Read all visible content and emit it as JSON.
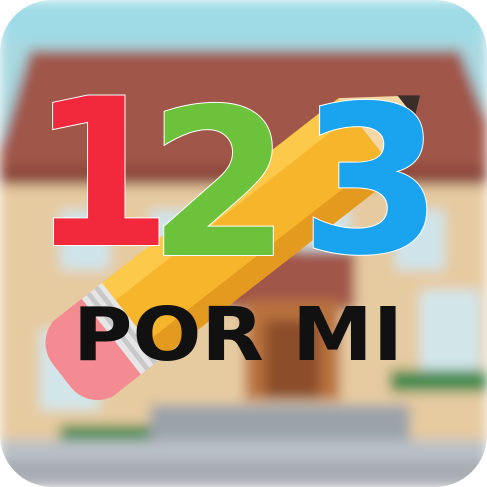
{
  "app_icon": {
    "digits": [
      {
        "text": "1",
        "color": "#f2283c"
      },
      {
        "text": "2",
        "color": "#6cc23a"
      },
      {
        "text": "3",
        "color": "#1aa3ef"
      }
    ],
    "wordmark": "POR MI",
    "wordmark_color": "#111111",
    "pencil_color": "#f7b52c",
    "eraser_color": "#f48a92",
    "background_scene": "school-building"
  }
}
